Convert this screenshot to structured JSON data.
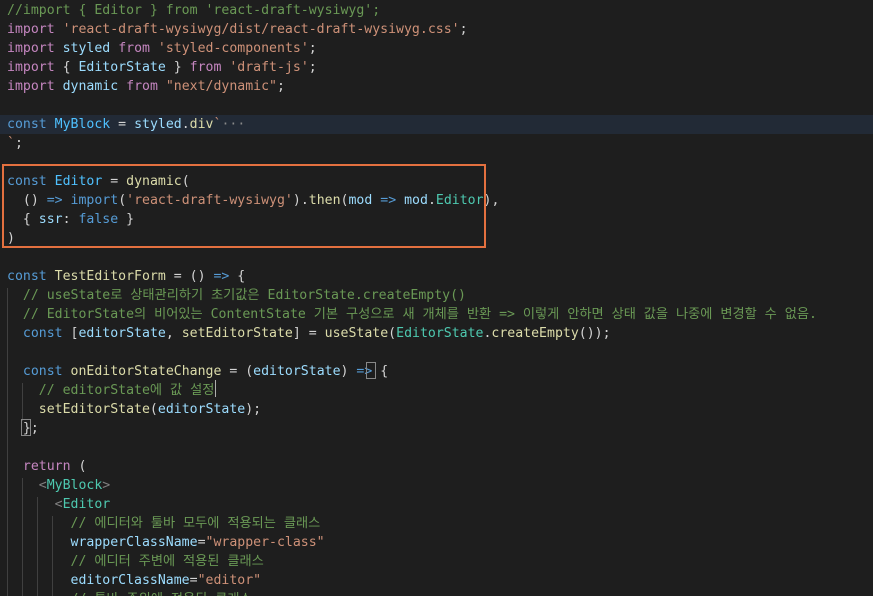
{
  "code_lines": [
    {
      "tokens": [
        {
          "t": "//import { Editor } from 'react-draft-wysiwyg';",
          "c": "comment"
        }
      ]
    },
    {
      "tokens": [
        {
          "t": "import",
          "c": "control"
        },
        {
          "t": " ",
          "c": "plain"
        },
        {
          "t": "'react-draft-wysiwyg/dist/react-draft-wysiwyg.css'",
          "c": "string"
        },
        {
          "t": ";",
          "c": "punct"
        }
      ]
    },
    {
      "tokens": [
        {
          "t": "import",
          "c": "control"
        },
        {
          "t": " ",
          "c": "plain"
        },
        {
          "t": "styled",
          "c": "var"
        },
        {
          "t": " ",
          "c": "plain"
        },
        {
          "t": "from",
          "c": "control"
        },
        {
          "t": " ",
          "c": "plain"
        },
        {
          "t": "'styled-components'",
          "c": "string"
        },
        {
          "t": ";",
          "c": "punct"
        }
      ]
    },
    {
      "tokens": [
        {
          "t": "import",
          "c": "control"
        },
        {
          "t": " { ",
          "c": "plain"
        },
        {
          "t": "EditorState",
          "c": "var"
        },
        {
          "t": " } ",
          "c": "plain"
        },
        {
          "t": "from",
          "c": "control"
        },
        {
          "t": " ",
          "c": "plain"
        },
        {
          "t": "'draft-js'",
          "c": "string"
        },
        {
          "t": ";",
          "c": "punct"
        }
      ]
    },
    {
      "tokens": [
        {
          "t": "import",
          "c": "control"
        },
        {
          "t": " ",
          "c": "plain"
        },
        {
          "t": "dynamic",
          "c": "var"
        },
        {
          "t": " ",
          "c": "plain"
        },
        {
          "t": "from",
          "c": "control"
        },
        {
          "t": " ",
          "c": "plain"
        },
        {
          "t": "\"next/dynamic\"",
          "c": "string"
        },
        {
          "t": ";",
          "c": "punct"
        }
      ]
    },
    {
      "tokens": []
    },
    {
      "highlight": true,
      "tokens": [
        {
          "t": "const",
          "c": "keyword"
        },
        {
          "t": " ",
          "c": "plain"
        },
        {
          "t": "MyBlock",
          "c": "const"
        },
        {
          "t": " = ",
          "c": "plain"
        },
        {
          "t": "styled",
          "c": "var"
        },
        {
          "t": ".",
          "c": "punct"
        },
        {
          "t": "div",
          "c": "func"
        },
        {
          "t": "`",
          "c": "string"
        },
        {
          "t": "···",
          "c": "ellipsis"
        }
      ]
    },
    {
      "tokens": [
        {
          "t": "`",
          "c": "string"
        },
        {
          "t": ";",
          "c": "punct"
        }
      ]
    },
    {
      "tokens": []
    },
    {
      "tokens": [
        {
          "t": "const",
          "c": "keyword"
        },
        {
          "t": " ",
          "c": "plain"
        },
        {
          "t": "Editor",
          "c": "const"
        },
        {
          "t": " = ",
          "c": "plain"
        },
        {
          "t": "dynamic",
          "c": "func"
        },
        {
          "t": "(",
          "c": "punct"
        }
      ]
    },
    {
      "tokens": [
        {
          "t": "  () ",
          "c": "plain"
        },
        {
          "t": "=>",
          "c": "keyword"
        },
        {
          "t": " ",
          "c": "plain"
        },
        {
          "t": "import",
          "c": "keyword"
        },
        {
          "t": "(",
          "c": "punct"
        },
        {
          "t": "'react-draft-wysiwyg'",
          "c": "string"
        },
        {
          "t": ").",
          "c": "punct"
        },
        {
          "t": "then",
          "c": "func"
        },
        {
          "t": "(",
          "c": "punct"
        },
        {
          "t": "mod",
          "c": "var"
        },
        {
          "t": " ",
          "c": "plain"
        },
        {
          "t": "=>",
          "c": "keyword"
        },
        {
          "t": " ",
          "c": "plain"
        },
        {
          "t": "mod",
          "c": "var"
        },
        {
          "t": ".",
          "c": "punct"
        },
        {
          "t": "Editor",
          "c": "type"
        },
        {
          "t": "),",
          "c": "punct"
        }
      ]
    },
    {
      "tokens": [
        {
          "t": "  { ",
          "c": "plain"
        },
        {
          "t": "ssr",
          "c": "var"
        },
        {
          "t": ": ",
          "c": "plain"
        },
        {
          "t": "false",
          "c": "keyword"
        },
        {
          "t": " }",
          "c": "plain"
        }
      ]
    },
    {
      "tokens": [
        {
          "t": ")",
          "c": "punct"
        }
      ]
    },
    {
      "tokens": []
    },
    {
      "tokens": [
        {
          "t": "const",
          "c": "keyword"
        },
        {
          "t": " ",
          "c": "plain"
        },
        {
          "t": "TestEditorForm",
          "c": "func"
        },
        {
          "t": " = () ",
          "c": "plain"
        },
        {
          "t": "=>",
          "c": "keyword"
        },
        {
          "t": " {",
          "c": "plain"
        }
      ]
    },
    {
      "tokens": [
        {
          "t": "  ",
          "c": "plain"
        },
        {
          "t": "// useState로 상태관리하기 초기값은 EditorState.createEmpty()",
          "c": "comment"
        }
      ]
    },
    {
      "tokens": [
        {
          "t": "  ",
          "c": "plain"
        },
        {
          "t": "// EditorState의 비어있는 ContentState 기본 구성으로 새 개체를 반환 => 이렇게 안하면 상태 값을 나중에 변경할 수 없음.",
          "c": "comment"
        }
      ]
    },
    {
      "tokens": [
        {
          "t": "  ",
          "c": "plain"
        },
        {
          "t": "const",
          "c": "keyword"
        },
        {
          "t": " [",
          "c": "plain"
        },
        {
          "t": "editorState",
          "c": "var"
        },
        {
          "t": ", ",
          "c": "plain"
        },
        {
          "t": "setEditorState",
          "c": "func"
        },
        {
          "t": "] = ",
          "c": "plain"
        },
        {
          "t": "useState",
          "c": "func"
        },
        {
          "t": "(",
          "c": "punct"
        },
        {
          "t": "EditorState",
          "c": "type"
        },
        {
          "t": ".",
          "c": "punct"
        },
        {
          "t": "createEmpty",
          "c": "func"
        },
        {
          "t": "());",
          "c": "punct"
        }
      ]
    },
    {
      "tokens": []
    },
    {
      "tokens": [
        {
          "t": "  ",
          "c": "plain"
        },
        {
          "t": "const",
          "c": "keyword"
        },
        {
          "t": " ",
          "c": "plain"
        },
        {
          "t": "onEditorStateChange",
          "c": "func"
        },
        {
          "t": " = (",
          "c": "plain"
        },
        {
          "t": "editorState",
          "c": "var"
        },
        {
          "t": ") ",
          "c": "plain"
        },
        {
          "t": "=>",
          "c": "keyword"
        },
        {
          "t": " {",
          "c": "plain"
        }
      ]
    },
    {
      "tokens": [
        {
          "t": "    ",
          "c": "plain"
        },
        {
          "t": "// editorState에 값 설정",
          "c": "comment"
        }
      ]
    },
    {
      "tokens": [
        {
          "t": "    ",
          "c": "plain"
        },
        {
          "t": "setEditorState",
          "c": "func"
        },
        {
          "t": "(",
          "c": "punct"
        },
        {
          "t": "editorState",
          "c": "var"
        },
        {
          "t": ");",
          "c": "punct"
        }
      ]
    },
    {
      "tokens": [
        {
          "t": "  };",
          "c": "plain"
        }
      ]
    },
    {
      "tokens": []
    },
    {
      "tokens": [
        {
          "t": "  ",
          "c": "plain"
        },
        {
          "t": "return",
          "c": "control"
        },
        {
          "t": " (",
          "c": "plain"
        }
      ]
    },
    {
      "tokens": [
        {
          "t": "    ",
          "c": "plain"
        },
        {
          "t": "<",
          "c": "tagpunct"
        },
        {
          "t": "MyBlock",
          "c": "tag"
        },
        {
          "t": ">",
          "c": "tagpunct"
        }
      ]
    },
    {
      "tokens": [
        {
          "t": "      ",
          "c": "plain"
        },
        {
          "t": "<",
          "c": "tagpunct"
        },
        {
          "t": "Editor",
          "c": "tag"
        }
      ]
    },
    {
      "tokens": [
        {
          "t": "        ",
          "c": "plain"
        },
        {
          "t": "// 에디터와 툴바 모두에 적용되는 클래스",
          "c": "comment"
        }
      ]
    },
    {
      "tokens": [
        {
          "t": "        ",
          "c": "plain"
        },
        {
          "t": "wrapperClassName",
          "c": "attr"
        },
        {
          "t": "=",
          "c": "plain"
        },
        {
          "t": "\"wrapper-class\"",
          "c": "string"
        }
      ]
    },
    {
      "tokens": [
        {
          "t": "        ",
          "c": "plain"
        },
        {
          "t": "// 에디터 주변에 적용된 클래스",
          "c": "comment"
        }
      ]
    },
    {
      "tokens": [
        {
          "t": "        ",
          "c": "plain"
        },
        {
          "t": "editorClassName",
          "c": "attr"
        },
        {
          "t": "=",
          "c": "plain"
        },
        {
          "t": "\"editor\"",
          "c": "string"
        }
      ]
    },
    {
      "tokens": [
        {
          "t": "        ",
          "c": "plain"
        },
        {
          "t": "// 툴바 주위에 적용된 클래스",
          "c": "comment"
        }
      ]
    }
  ]
}
